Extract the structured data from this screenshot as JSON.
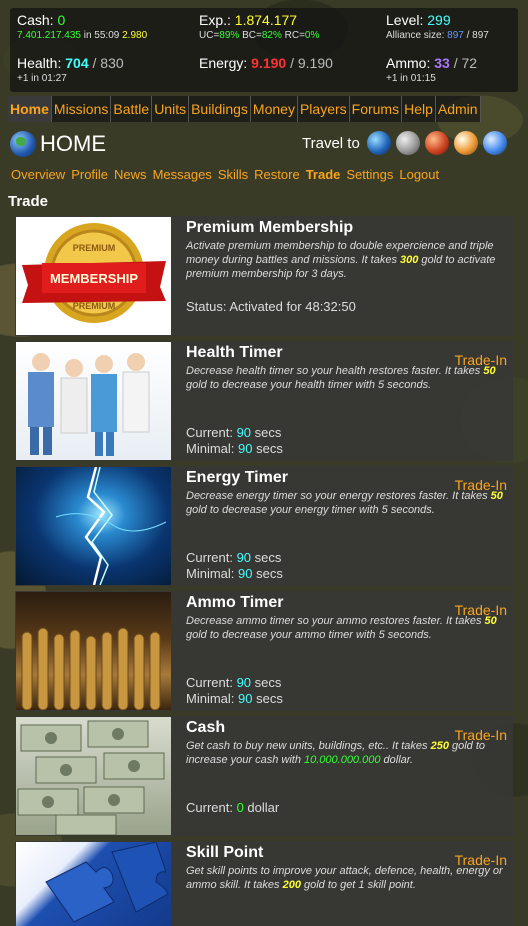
{
  "stats": {
    "cash_label": "Cash:",
    "cash_value": "0",
    "cash_bank": "7.401.217.435",
    "cash_in": "in 55:09",
    "cash_extra": "2.980",
    "exp_label": "Exp.:",
    "exp_value": "1.874.177",
    "uc_label": "UC=",
    "uc": "89%",
    "bc_label": "BC=",
    "bc": "82%",
    "rc_label": "RC=",
    "rc": "0%",
    "level_label": "Level:",
    "level_value": "299",
    "alliance_label": "Alliance size:",
    "alliance_value": "897",
    "alliance_max": "/ 897",
    "health_label": "Health:",
    "health_value": "704",
    "health_max": "/ 830",
    "health_sub": "+1 in 01:27",
    "energy_label": "Energy:",
    "energy_value": "9.190",
    "energy_max": "/ 9.190",
    "ammo_label": "Ammo:",
    "ammo_value": "33",
    "ammo_max": "/ 72",
    "ammo_sub": "+1 in 01:15"
  },
  "nav": [
    "Home",
    "Missions",
    "Battle",
    "Units",
    "Buildings",
    "Money",
    "Players",
    "Forums",
    "Help",
    "Admin"
  ],
  "home_title": "HOME",
  "travel_label": "Travel to",
  "planets": [
    "earth-planet",
    "moon-planet",
    "mars-planet",
    "venus-planet",
    "neptune-planet"
  ],
  "subnav": [
    "Overview",
    "Profile",
    "News",
    "Messages",
    "Skills",
    "Restore",
    "Trade",
    "Settings",
    "Logout"
  ],
  "section_title": "Trade",
  "cards": [
    {
      "title": "Premium Membership",
      "desc_a": "Activate premium membership to double expercience and triple money during battles and missions. It takes ",
      "gold": "300",
      "desc_b": " gold to activate premium membership for 3 days.",
      "status": "Status: Activated for 48:32:50"
    },
    {
      "title": "Health Timer",
      "trade": "Trade-In",
      "desc_a": "Decrease health timer so your health restores faster. It takes ",
      "gold": "50",
      "desc_b": " gold to decrease your health timer with 5 seconds.",
      "cur_label": "Current: ",
      "cur": "90",
      "cur_unit": " secs",
      "min_label": "Minimal: ",
      "min": "90",
      "min_unit": " secs"
    },
    {
      "title": "Energy Timer",
      "trade": "Trade-In",
      "desc_a": "Decrease energy timer so your energy restores faster. It takes ",
      "gold": "50",
      "desc_b": " gold to decrease your energy timer with 5 seconds.",
      "cur_label": "Current: ",
      "cur": "90",
      "cur_unit": " secs",
      "min_label": "Minimal: ",
      "min": "90",
      "min_unit": " secs"
    },
    {
      "title": "Ammo Timer",
      "trade": "Trade-In",
      "desc_a": "Decrease ammo timer so your ammo restores faster. It takes ",
      "gold": "50",
      "desc_b": " gold to decrease your ammo timer with 5 seconds.",
      "cur_label": "Current: ",
      "cur": "90",
      "cur_unit": " secs",
      "min_label": "Minimal: ",
      "min": "90",
      "min_unit": " secs"
    },
    {
      "title": "Cash",
      "trade": "Trade-In",
      "desc_a": "Get cash to buy new units, buildings, etc.. It takes ",
      "gold": "250",
      "desc_b": " gold to increase your cash with ",
      "amount": "10.000.000.000",
      "desc_c": " dollar.",
      "cur_label": "Current: ",
      "cur": "0",
      "cur_unit": " dollar"
    },
    {
      "title": "Skill Point",
      "trade": "Trade-In",
      "desc_a": "Get skill points to improve your attack, defence, health, energy or ammo skill. It takes ",
      "gold": "200",
      "desc_b": " gold to get 1 skill point."
    }
  ],
  "colors": {
    "link": "#f9a51e",
    "green": "#33ff33",
    "cyan": "#44ffff",
    "red": "#ff3333",
    "purple": "#aa77ff",
    "yellow": "#ffff33"
  }
}
